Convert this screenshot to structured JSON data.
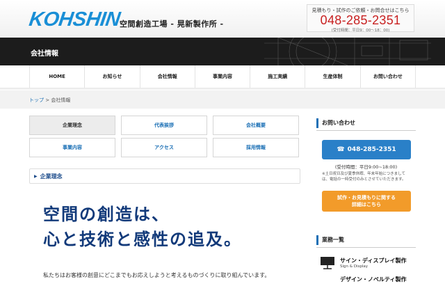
{
  "header": {
    "logo": "KOHSHIN",
    "tagline": "空間創造工場 - 晃新製作所 -",
    "contact_top": "見積もり・試作のご依頼・お問合せはこちら",
    "phone": "048-285-2351",
    "hours": "(受付時間：平日9：00〜18：00)"
  },
  "banner": {
    "title": "会社情報"
  },
  "nav": {
    "items": [
      "HOME",
      "お知らせ",
      "会社情報",
      "事業内容",
      "施工実績",
      "生産体制",
      "お問い合わせ"
    ]
  },
  "breadcrumb": {
    "home": "トップ",
    "separator": ">",
    "current": "会社情報"
  },
  "submenu": {
    "items": [
      "企業理念",
      "代表挨拶",
      "会社概要",
      "事業内容",
      "アクセス",
      "採用情報"
    ],
    "active_index": 0
  },
  "section": {
    "title": "企業理念"
  },
  "hero": {
    "line1": "空間の創造は、",
    "line2": "心と技術と感性の追及。"
  },
  "body": {
    "text": "私たちはお客様の創意にどこまでもお応えしようと考えるものづくりに取り組んでいます。"
  },
  "sidebar": {
    "contact_title": "お問い合わせ",
    "phone_label": "048-285-2351",
    "hours": "(受付時間：平日9:00~18:00)",
    "note": "※土日祝日及び夏季休暇、年末年始につきましては、電話の一時受付のみとさせていただきます。",
    "estimate_line1": "試作・お見積もりに関する",
    "estimate_line2": "詳細はこちら",
    "business_title": "業務一覧",
    "business_items": [
      {
        "jp": "サイン・ディスプレイ製作",
        "en": "Sign & Display"
      },
      {
        "jp": "デザイン・ノベルティ製作"
      }
    ]
  },
  "colors": {
    "brand_blue": "#1a8fd6",
    "link_blue": "#1a6fb5",
    "heading_navy": "#123a7a",
    "phone_red": "#c82020",
    "cta_orange": "#f29b2a",
    "phone_button": "#2a80c8",
    "banner_dark": "#1c1c1c"
  },
  "icons": {
    "phone": "phone-icon",
    "triangle": "triangle-right-icon",
    "sign": "sign-display-icon"
  }
}
